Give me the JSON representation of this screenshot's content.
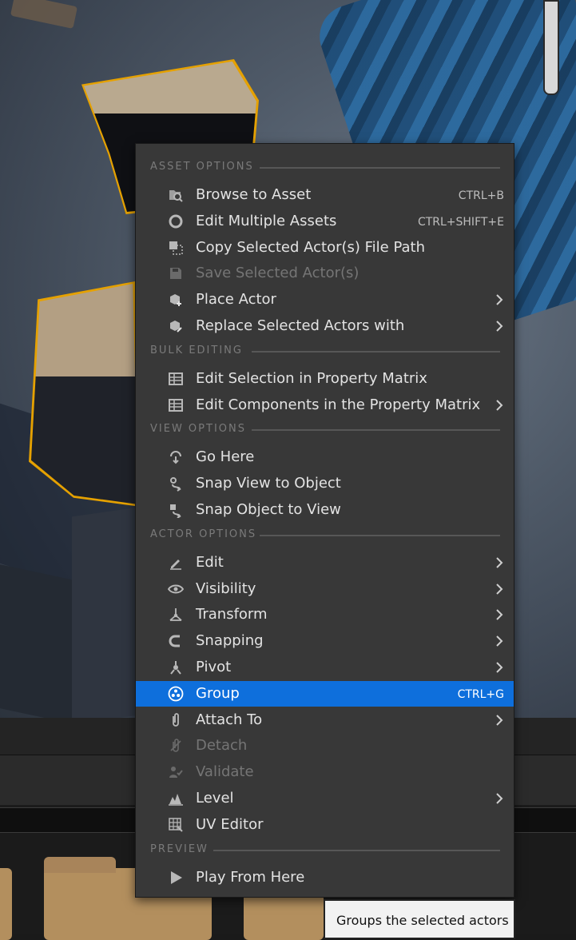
{
  "menu": {
    "sections": [
      {
        "title": "ASSET OPTIONS",
        "items": [
          {
            "label": "Browse to Asset",
            "shortcut": "CTRL+B",
            "icon": "browse-icon"
          },
          {
            "label": "Edit Multiple Assets",
            "shortcut": "CTRL+SHIFT+E",
            "icon": "circle-icon"
          },
          {
            "label": "Copy Selected Actor(s) File Path",
            "icon": "copy-path-icon"
          },
          {
            "label": "Save Selected Actor(s)",
            "icon": "save-icon",
            "disabled": true
          },
          {
            "label": "Place Actor",
            "icon": "place-actor-icon",
            "submenu": true
          },
          {
            "label": "Replace Selected Actors with",
            "icon": "replace-actor-icon",
            "submenu": true
          }
        ]
      },
      {
        "title": "BULK EDITING",
        "items": [
          {
            "label": "Edit Selection in Property Matrix",
            "icon": "matrix-icon"
          },
          {
            "label": "Edit Components in the Property Matrix",
            "icon": "matrix-icon",
            "submenu": true
          }
        ]
      },
      {
        "title": "VIEW OPTIONS",
        "items": [
          {
            "label": "Go Here",
            "icon": "go-here-icon"
          },
          {
            "label": "Snap View to Object",
            "icon": "snap-view-icon"
          },
          {
            "label": "Snap Object to View",
            "icon": "snap-object-icon"
          }
        ]
      },
      {
        "title": "ACTOR OPTIONS",
        "items": [
          {
            "label": "Edit",
            "icon": "pencil-icon",
            "submenu": true
          },
          {
            "label": "Visibility",
            "icon": "eye-icon",
            "submenu": true
          },
          {
            "label": "Transform",
            "icon": "transform-icon",
            "submenu": true
          },
          {
            "label": "Snapping",
            "icon": "magnet-icon",
            "submenu": true
          },
          {
            "label": "Pivot",
            "icon": "pivot-icon",
            "submenu": true
          },
          {
            "label": "Group",
            "shortcut": "CTRL+G",
            "icon": "group-icon",
            "highlighted": true
          },
          {
            "label": "Attach To",
            "icon": "paperclip-icon",
            "submenu": true
          },
          {
            "label": "Detach",
            "icon": "detach-icon",
            "disabled": true
          },
          {
            "label": "Validate",
            "icon": "validate-icon",
            "disabled": true
          },
          {
            "label": "Level",
            "icon": "level-icon",
            "submenu": true
          },
          {
            "label": "UV Editor",
            "icon": "uv-editor-icon"
          }
        ]
      },
      {
        "title": "PREVIEW",
        "items": [
          {
            "label": "Play From Here",
            "icon": "play-icon"
          }
        ]
      }
    ]
  },
  "tooltip": {
    "text": "Groups the selected actors"
  },
  "colors": {
    "highlight": "#0e6fdc",
    "selection_outline": "#e5a100",
    "menu_bg": "#383838"
  }
}
